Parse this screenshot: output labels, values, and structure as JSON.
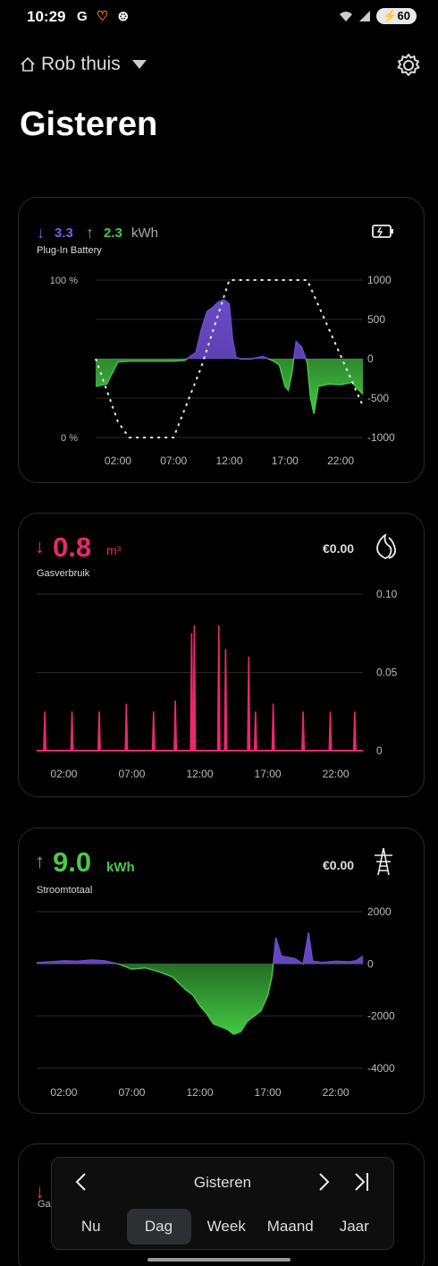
{
  "status": {
    "time": "10:29",
    "battery": "60",
    "left_icons": [
      "G",
      "♡",
      "⊛"
    ]
  },
  "topbar": {
    "location": "Rob thuis"
  },
  "page": {
    "title": "Gisteren"
  },
  "battery_card": {
    "down_value": "3.3",
    "up_value": "2.3",
    "unit": "kWh",
    "label": "Plug-In Battery",
    "colors": {
      "charge": "#6a4bc9",
      "discharge": "#4ad04a",
      "down_arrow": "#7b5ce8",
      "up_arrow": "#49c94a"
    }
  },
  "gas_card": {
    "value": "0.8",
    "unit": "m³",
    "cost": "€0.00",
    "label": "Gasverbruik",
    "color": "#e8286f"
  },
  "power_card": {
    "value": "9.0",
    "unit": "kWh",
    "cost": "€0.00",
    "label": "Stroomtotaal",
    "color": "#49c94a"
  },
  "partial_card": {
    "label": "Ga"
  },
  "navigator": {
    "title": "Gisteren",
    "tabs": [
      "Nu",
      "Dag",
      "Week",
      "Maand",
      "Jaar"
    ],
    "active_tab": "Dag"
  },
  "chart_data": [
    {
      "type": "area",
      "x_ticks": [
        "02:00",
        "07:00",
        "12:00",
        "17:00",
        "22:00"
      ],
      "y_left_ticks": [
        "100 %",
        "0 %"
      ],
      "y_right_ticks": [
        "1000",
        "500",
        "0",
        "-500",
        "-1000"
      ],
      "ylim": [
        -1000,
        1000
      ],
      "x_hours": [
        0,
        1,
        2,
        3,
        4,
        5,
        6,
        7,
        8,
        9,
        9.5,
        10,
        10.5,
        11,
        11.5,
        12,
        12.3,
        12.6,
        13,
        14,
        15,
        15.5,
        16,
        16.5,
        17,
        17.3,
        17.6,
        18,
        18.5,
        19,
        19.3,
        19.6,
        20,
        21,
        22,
        23,
        24
      ],
      "power_w": [
        -350,
        -320,
        -40,
        -30,
        -30,
        -30,
        -30,
        -30,
        -20,
        80,
        380,
        600,
        650,
        720,
        750,
        700,
        250,
        20,
        0,
        0,
        30,
        0,
        -30,
        -80,
        -350,
        -400,
        -200,
        220,
        150,
        -50,
        -500,
        -700,
        -350,
        -320,
        -330,
        -300,
        -450
      ],
      "soc_hours": [
        0,
        2,
        3,
        7,
        9.5,
        12,
        13,
        17.5,
        19,
        24
      ],
      "soc_percent": [
        50,
        10,
        0,
        0,
        45,
        100,
        100,
        100,
        100,
        20
      ],
      "grid": true
    },
    {
      "type": "bar",
      "x_ticks": [
        "02:00",
        "07:00",
        "12:00",
        "17:00",
        "22:00"
      ],
      "y_ticks": [
        "0.10",
        "0.05",
        "0"
      ],
      "ylim": [
        0,
        0.1
      ],
      "spike_hours": [
        0.6,
        2.6,
        4.6,
        6.6,
        8.6,
        10.2,
        11.4,
        11.6,
        13.4,
        13.9,
        15.6,
        16.1,
        17.4,
        19.6,
        21.6,
        23.4
      ],
      "spike_m3": [
        0.025,
        0.025,
        0.025,
        0.03,
        0.025,
        0.032,
        0.075,
        0.08,
        0.08,
        0.065,
        0.06,
        0.025,
        0.03,
        0.025,
        0.025,
        0.025
      ],
      "grid": true
    },
    {
      "type": "area",
      "x_ticks": [
        "02:00",
        "07:00",
        "12:00",
        "17:00",
        "22:00"
      ],
      "y_ticks": [
        "2000",
        "0",
        "-2000",
        "-4000"
      ],
      "ylim": [
        -4000,
        2000
      ],
      "x_hours": [
        0,
        1,
        2,
        3,
        4,
        5,
        6,
        7,
        8,
        9,
        10,
        11,
        11.5,
        12,
        12.5,
        13,
        13.5,
        14,
        14.5,
        15,
        15.5,
        16,
        16.5,
        17,
        17.3,
        17.6,
        18,
        19,
        19.6,
        20,
        20.3,
        21,
        22,
        23,
        23.5,
        24
      ],
      "power_w": [
        50,
        80,
        120,
        100,
        150,
        120,
        0,
        -200,
        -150,
        -300,
        -500,
        -1000,
        -1200,
        -1600,
        -1900,
        -2300,
        -2400,
        -2500,
        -2700,
        -2600,
        -2200,
        -2000,
        -1800,
        -1200,
        -500,
        1000,
        300,
        200,
        0,
        1200,
        100,
        50,
        100,
        80,
        120,
        300
      ],
      "grid": true
    }
  ]
}
